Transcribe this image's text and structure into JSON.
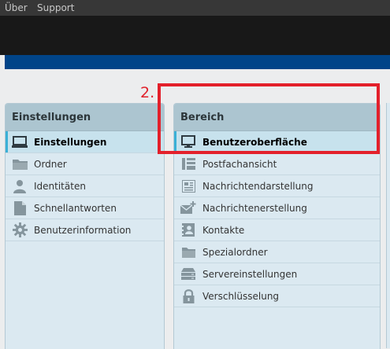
{
  "menu": {
    "about": "Über",
    "support": "Support"
  },
  "annotation": {
    "step": "2."
  },
  "settings_panel": {
    "title": "Einstellungen",
    "items": [
      {
        "label": "Einstellungen",
        "icon": "monitor-icon",
        "selected": true
      },
      {
        "label": "Ordner",
        "icon": "folder-icon",
        "selected": false
      },
      {
        "label": "Identitäten",
        "icon": "person-icon",
        "selected": false
      },
      {
        "label": "Schnellantworten",
        "icon": "document-icon",
        "selected": false
      },
      {
        "label": "Benutzerinformation",
        "icon": "gear-icon",
        "selected": false
      }
    ]
  },
  "section_panel": {
    "title": "Bereich",
    "items": [
      {
        "label": "Benutzeroberfläche",
        "icon": "monitor-icon",
        "selected": true
      },
      {
        "label": "Postfachansicht",
        "icon": "mailbox-layout-icon",
        "selected": false
      },
      {
        "label": "Nachrichtendarstellung",
        "icon": "message-view-icon",
        "selected": false
      },
      {
        "label": "Nachrichtenerstellung",
        "icon": "compose-mail-icon",
        "selected": false
      },
      {
        "label": "Kontakte",
        "icon": "contacts-icon",
        "selected": false
      },
      {
        "label": "Spezialordner",
        "icon": "folder-icon",
        "selected": false
      },
      {
        "label": "Servereinstellungen",
        "icon": "server-icon",
        "selected": false
      },
      {
        "label": "Verschlüsselung",
        "icon": "lock-icon",
        "selected": false
      }
    ]
  },
  "colors": {
    "accent_blue": "#004488",
    "selection_bar": "#3bb0d6",
    "annotation_red": "#e3202b"
  }
}
